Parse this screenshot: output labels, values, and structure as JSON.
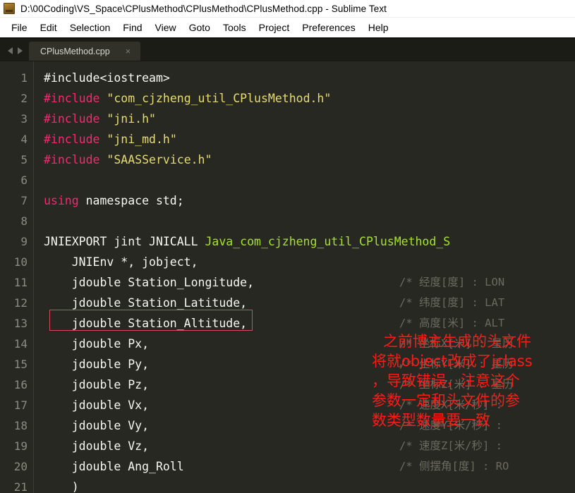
{
  "window": {
    "title": "D:\\00Coding\\VS_Space\\CPlusMethod\\CPlusMethod\\CPlusMethod.cpp - Sublime Text",
    "app_icon": "sublime-text-icon"
  },
  "menubar": {
    "items": [
      {
        "label": "File"
      },
      {
        "label": "Edit"
      },
      {
        "label": "Selection"
      },
      {
        "label": "Find"
      },
      {
        "label": "View"
      },
      {
        "label": "Goto"
      },
      {
        "label": "Tools"
      },
      {
        "label": "Project"
      },
      {
        "label": "Preferences"
      },
      {
        "label": "Help"
      }
    ]
  },
  "tabbar": {
    "prev_arrow": "chevron-left-icon",
    "next_arrow": "chevron-right-icon",
    "tabs": [
      {
        "label": "CPlusMethod.cpp",
        "close": "×",
        "active": true
      }
    ]
  },
  "editor": {
    "gutter_numbers": [
      "1",
      "2",
      "3",
      "4",
      "5",
      "6",
      "7",
      "8",
      "9",
      "10",
      "11",
      "12",
      "13",
      "14",
      "15",
      "16",
      "17",
      "18",
      "19",
      "20",
      "21"
    ],
    "lines": [
      {
        "n": "1",
        "segments": [
          {
            "t": "#include<iostream>",
            "c": "plain"
          }
        ]
      },
      {
        "n": "2",
        "segments": [
          {
            "t": "#include",
            "c": "pre"
          },
          {
            "t": " ",
            "c": "plain"
          },
          {
            "t": "\"com_cjzheng_util_CPlusMethod.h\"",
            "c": "str"
          }
        ]
      },
      {
        "n": "3",
        "segments": [
          {
            "t": "#include",
            "c": "pre"
          },
          {
            "t": " ",
            "c": "plain"
          },
          {
            "t": "\"jni.h\"",
            "c": "str"
          }
        ]
      },
      {
        "n": "4",
        "segments": [
          {
            "t": "#include",
            "c": "pre"
          },
          {
            "t": " ",
            "c": "plain"
          },
          {
            "t": "\"jni_md.h\"",
            "c": "str"
          }
        ]
      },
      {
        "n": "5",
        "segments": [
          {
            "t": "#include",
            "c": "pre"
          },
          {
            "t": " ",
            "c": "plain"
          },
          {
            "t": "\"SAASService.h\"",
            "c": "str"
          }
        ]
      },
      {
        "n": "6",
        "segments": [
          {
            "t": "",
            "c": "plain"
          }
        ]
      },
      {
        "n": "7",
        "segments": [
          {
            "t": "using",
            "c": "kw"
          },
          {
            "t": " namespace std;",
            "c": "plain"
          }
        ]
      },
      {
        "n": "8",
        "segments": [
          {
            "t": "",
            "c": "plain"
          }
        ]
      },
      {
        "n": "9",
        "segments": [
          {
            "t": "JNIEXPORT jint JNICALL ",
            "c": "plain"
          },
          {
            "t": "Java_com_cjzheng_util_CPlusMethod_S",
            "c": "fn"
          }
        ]
      },
      {
        "n": "10",
        "segments": [
          {
            "t": "    JNIEnv *, jobject,",
            "c": "plain"
          }
        ]
      },
      {
        "n": "11",
        "segments": [
          {
            "t": "    jdouble Station_Longitude,",
            "c": "plain"
          }
        ]
      },
      {
        "n": "12",
        "segments": [
          {
            "t": "    jdouble Station_Latitude,",
            "c": "plain"
          }
        ]
      },
      {
        "n": "13",
        "segments": [
          {
            "t": "    jdouble Station_Altitude,",
            "c": "plain"
          }
        ]
      },
      {
        "n": "14",
        "segments": [
          {
            "t": "    jdouble Px,",
            "c": "plain"
          }
        ]
      },
      {
        "n": "15",
        "segments": [
          {
            "t": "    jdouble Py,",
            "c": "plain"
          }
        ]
      },
      {
        "n": "16",
        "segments": [
          {
            "t": "    jdouble Pz,",
            "c": "plain"
          }
        ]
      },
      {
        "n": "17",
        "segments": [
          {
            "t": "    jdouble Vx,",
            "c": "plain"
          }
        ]
      },
      {
        "n": "18",
        "segments": [
          {
            "t": "    jdouble Vy,",
            "c": "plain"
          }
        ]
      },
      {
        "n": "19",
        "segments": [
          {
            "t": "    jdouble Vz,",
            "c": "plain"
          }
        ]
      },
      {
        "n": "20",
        "segments": [
          {
            "t": "    jdouble Ang_Roll",
            "c": "plain"
          }
        ]
      },
      {
        "n": "21",
        "segments": [
          {
            "t": "    )",
            "c": "plain"
          }
        ]
      }
    ],
    "comment_column": [
      {
        "line": "11",
        "text": "/* 经度[度] : LON"
      },
      {
        "line": "12",
        "text": "/* 纬度[度] : LAT"
      },
      {
        "line": "13",
        "text": "/* 高度[米] : ALT"
      },
      {
        "line": "14",
        "text": "/* 坐标X[米] : 星历"
      },
      {
        "line": "15",
        "text": "/* 坐标Y[米] : 星历"
      },
      {
        "line": "16",
        "text": "/* 坐标Z[米] : 星历"
      },
      {
        "line": "17",
        "text": "/* 速度X[米/秒] : "
      },
      {
        "line": "18",
        "text": "/* 速度Y[米/秒] : "
      },
      {
        "line": "19",
        "text": "/* 速度Z[米/秒] : "
      },
      {
        "line": "20",
        "text": "/* 侧摆角[度] : RO"
      }
    ],
    "annotation": {
      "color": "#fb1c18",
      "lines": [
        "之前博主生成的头文件",
        "将就object改成了jclass",
        "，导致错误，注意这个",
        "参数一定和头文件的参",
        "数类型数量要一致"
      ]
    },
    "highlight_box": {
      "target_line": "10",
      "border_color": "#d9485c"
    }
  },
  "colors": {
    "editor_bg": "#272822",
    "gutter_text": "#8b8b80",
    "code_text": "#f8f8f2",
    "preprocessor": "#f92672",
    "string": "#e6db74",
    "function": "#a6e22e",
    "comment": "#6a6a5f",
    "tab_active_bg": "#31312a",
    "tabbar_bg": "#1c1c17",
    "menubar_bg": "#ffffff"
  }
}
